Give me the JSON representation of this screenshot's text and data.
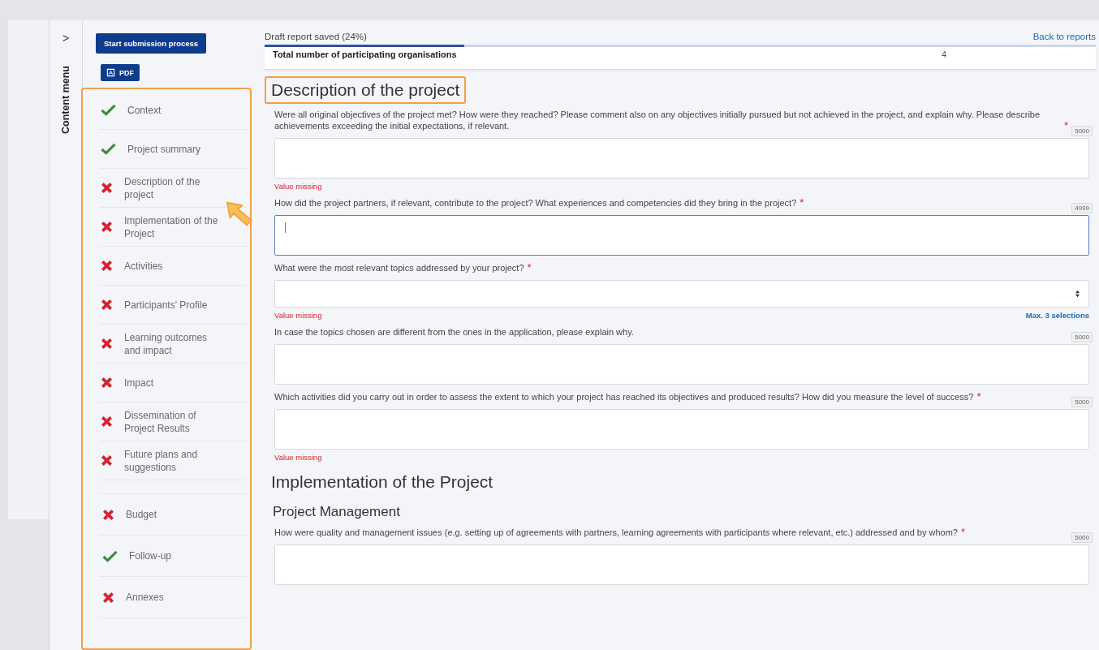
{
  "sidebar": {
    "toggle": ">",
    "title": "Content menu",
    "submit_button": "Start submission process",
    "pdf_button": "PDF",
    "item_groups": [
      [
        {
          "label": "Context",
          "complete": true
        },
        {
          "label": "Project summary",
          "complete": true
        },
        {
          "label": "Description of the project",
          "complete": false
        },
        {
          "label": "Implementation of the Project",
          "complete": false
        },
        {
          "label": "Activities",
          "complete": false
        },
        {
          "label": "Participants' Profile",
          "complete": false
        },
        {
          "label": "Learning outcomes and impact",
          "complete": false
        },
        {
          "label": "Impact",
          "complete": false
        },
        {
          "label": "Dissemination of Project Results",
          "complete": false
        },
        {
          "label": "Future plans and suggestions",
          "complete": false
        }
      ],
      [
        {
          "label": "Budget",
          "complete": false
        },
        {
          "label": "Follow-up",
          "complete": true
        },
        {
          "label": "Annexes",
          "complete": false
        }
      ]
    ]
  },
  "header": {
    "status": "Draft report saved (24%)",
    "progress": {
      "level": 0.24
    },
    "back_link": "Back to reports"
  },
  "summary_row": {
    "label": "Total number of participating organisations",
    "value": "4"
  },
  "content": [
    {
      "kind": "heading",
      "text": "Description of the project",
      "highlighted": true
    },
    {
      "kind": "textarea",
      "question": "Were all original objectives of the project met? How were they reached? Please comment also on any objectives initially pursued but not achieved in the project, and explain why. Please describe achievements exceeding the initial expectations, if relevant.",
      "required_mark": "*",
      "counter": "5000",
      "error": "Value missing",
      "focused": false
    },
    {
      "kind": "textarea",
      "question": "How did the project partners, if relevant, contribute to the project? What experiences and competencies did they bring in the project?",
      "required_mark": "*",
      "counter": "4999",
      "focused": true
    },
    {
      "kind": "select",
      "question": "What were the most relevant topics addressed by your project?",
      "required_mark": "*",
      "error": "Value missing",
      "hint": "Max. 3 selections"
    },
    {
      "kind": "textarea",
      "question": "In case the topics chosen are different from the ones in the application, please explain why.",
      "counter": "5000",
      "focused": false
    },
    {
      "kind": "textarea",
      "question": "Which activities did you carry out in order to assess the extent to which your project has reached its objectives and produced results? How did you measure the level of success?",
      "required_mark": "*",
      "counter": "5000",
      "error": "Value missing",
      "focused": false
    },
    {
      "kind": "heading",
      "text": "Implementation of the Project",
      "highlighted": false
    },
    {
      "kind": "subheading",
      "text": "Project Management"
    },
    {
      "kind": "textarea",
      "question": "How were quality and management issues (e.g. setting up of agreements with partners, learning agreements with participants where relevant, etc.) addressed and by whom?",
      "required_mark": "*",
      "counter": "5000",
      "focused": false
    }
  ]
}
